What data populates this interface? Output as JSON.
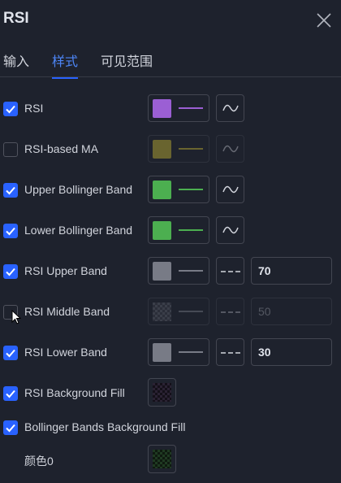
{
  "dialog": {
    "title": "RSI"
  },
  "tabs": [
    {
      "label": "输入",
      "active": false
    },
    {
      "label": "样式",
      "active": true
    },
    {
      "label": "可见范围",
      "active": false
    }
  ],
  "rows": [
    {
      "label": "RSI",
      "checked": true,
      "color": "#9b5fd4",
      "plot_icon": "wave-icon"
    },
    {
      "label": "RSI-based MA",
      "checked": false,
      "color": "#c4b432",
      "plot_icon": "wave-icon"
    },
    {
      "label": "Upper Bollinger Band",
      "checked": true,
      "color": "#4caf50",
      "plot_icon": "wave-icon"
    },
    {
      "label": "Lower Bollinger Band",
      "checked": true,
      "color": "#4caf50",
      "plot_icon": "wave-icon"
    },
    {
      "label": "RSI Upper Band",
      "checked": true,
      "color": "#787b86",
      "line_style": "dashed",
      "value": "70"
    },
    {
      "label": "RSI Middle Band",
      "checked": false,
      "color": "#787b86",
      "line_style": "dashed",
      "value": "50"
    },
    {
      "label": "RSI Lower Band",
      "checked": true,
      "color": "#787b86",
      "line_style": "dashed",
      "value": "30"
    },
    {
      "label": "RSI Background Fill",
      "checked": true,
      "color": "#7e57c2"
    },
    {
      "label": "Bollinger Bands Background Fill",
      "checked": true
    },
    {
      "label": "颜色0",
      "color": "#4caf50"
    }
  ],
  "colors": {
    "accent": "#2962ff",
    "background": "#1e222d",
    "border": "#434651"
  }
}
